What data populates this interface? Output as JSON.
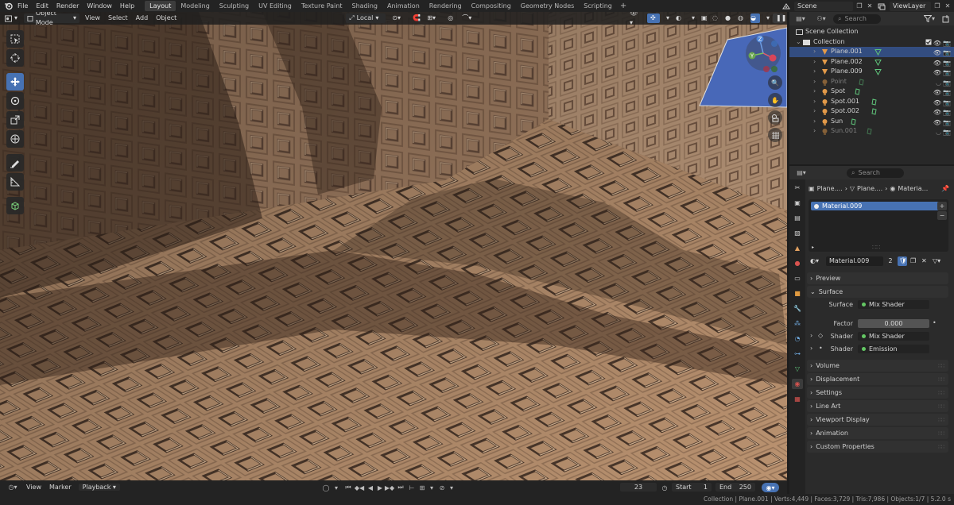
{
  "topbar": {
    "menus": [
      "File",
      "Edit",
      "Render",
      "Window",
      "Help"
    ],
    "workspaces": [
      "Layout",
      "Modeling",
      "Sculpting",
      "UV Editing",
      "Texture Paint",
      "Shading",
      "Animation",
      "Rendering",
      "Compositing",
      "Geometry Nodes",
      "Scripting"
    ],
    "active_workspace": "Layout",
    "add_tab": "+",
    "scene": "Scene",
    "view_layer": "ViewLayer"
  },
  "viewport": {
    "mode": "Object Mode",
    "menus": [
      "View",
      "Select",
      "Add",
      "Object"
    ],
    "transform_orientation": "Local",
    "colors": {
      "wall": "#b08a6c",
      "floor": "#c49a76",
      "shadow": "#5e4636",
      "tile": "#a07e62"
    }
  },
  "outliner": {
    "search_placeholder": "Search",
    "scene_collection": "Scene Collection",
    "collection": "Collection",
    "items": [
      {
        "name": "Plane.001",
        "type": "mesh",
        "selected": true,
        "dim": false
      },
      {
        "name": "Plane.002",
        "type": "mesh",
        "selected": false,
        "dim": false
      },
      {
        "name": "Plane.009",
        "type": "mesh",
        "selected": false,
        "dim": false
      },
      {
        "name": "Point",
        "type": "light",
        "selected": false,
        "dim": true
      },
      {
        "name": "Spot",
        "type": "light",
        "selected": false,
        "dim": false
      },
      {
        "name": "Spot.001",
        "type": "light",
        "selected": false,
        "dim": false
      },
      {
        "name": "Spot.002",
        "type": "light",
        "selected": false,
        "dim": false
      },
      {
        "name": "Sun",
        "type": "light",
        "selected": false,
        "dim": false
      },
      {
        "name": "Sun.001",
        "type": "light",
        "selected": false,
        "dim": true
      }
    ]
  },
  "properties": {
    "search_placeholder": "Search",
    "breadcrumb": [
      "Plane....",
      "Plane....",
      "Materia..."
    ],
    "material_slot": "Material.009",
    "material_name": "Material.009",
    "user_count": "2",
    "panels": {
      "preview": "Preview",
      "surface": "Surface",
      "volume": "Volume",
      "displacement": "Displacement",
      "settings": "Settings",
      "line_art": "Line Art",
      "viewport_display": "Viewport Display",
      "animation": "Animation",
      "custom_properties": "Custom Properties"
    },
    "surface": {
      "surface_label": "Surface",
      "surface_value": "Mix Shader",
      "factor_label": "Factor",
      "factor_value": "0.000",
      "shader1_label": "Shader",
      "shader1_value": "Mix Shader",
      "shader2_label": "Shader",
      "shader2_value": "Emission"
    }
  },
  "timeline": {
    "menus": [
      "View",
      "Marker",
      "Playback"
    ],
    "current_frame": "23",
    "start_label": "Start",
    "start_value": "1",
    "end_label": "End",
    "end_value": "250"
  },
  "statusbar": {
    "text": "Collection | Plane.001 | Verts:4,449 | Faces:3,729 | Tris:7,986 | Objects:1/7 | 5.2.0 s"
  }
}
